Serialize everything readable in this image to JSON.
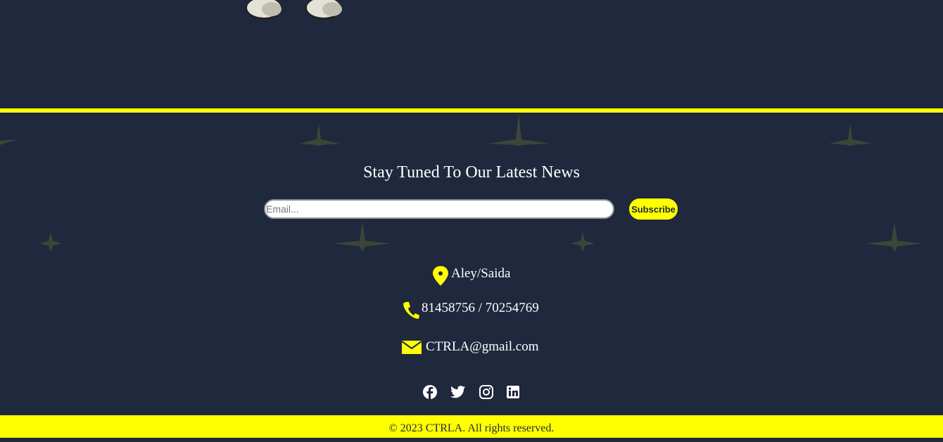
{
  "newsletter": {
    "title": "Stay Tuned To Our Latest News",
    "email_placeholder": "Email...",
    "email_value": "",
    "subscribe_label": "Subscribe"
  },
  "contact": {
    "location": "Aley/Saida",
    "phone": "81458756 / 70254769",
    "email": "CTRLA@gmail.com",
    "icons": [
      "location-pin-icon",
      "phone-icon",
      "envelope-icon"
    ]
  },
  "socials": [
    "facebook-icon",
    "twitter-icon",
    "instagram-icon",
    "linkedin-icon"
  ],
  "footer": {
    "copyright": "© 2023 CTRLA. All rights reserved."
  },
  "colors": {
    "background": "#1f283d",
    "accent": "#ffff00",
    "text": "#ffffff"
  }
}
